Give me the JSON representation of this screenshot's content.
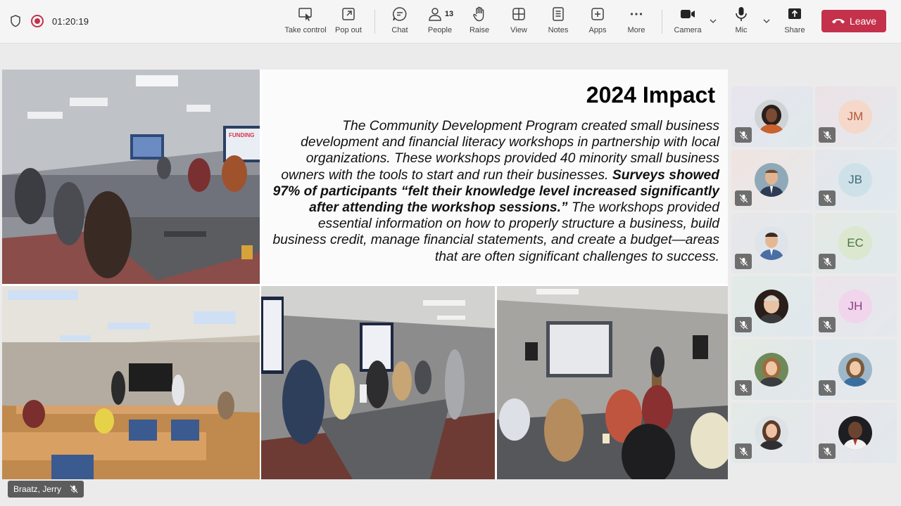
{
  "meeting": {
    "timer": "01:20:19"
  },
  "toolbar": {
    "take_control": "Take control",
    "pop_out": "Pop out",
    "chat": "Chat",
    "people": "People",
    "people_count": "13",
    "raise": "Raise",
    "view": "View",
    "notes": "Notes",
    "apps": "Apps",
    "more": "More",
    "camera": "Camera",
    "mic": "Mic",
    "share": "Share",
    "leave": "Leave"
  },
  "slide": {
    "title": "2024 Impact",
    "body_part1": "The Community Development Program created small business development and financial literacy workshops in partnership with local organizations. These workshops provided 40 minority small business owners with the tools to start and run their businesses.",
    "body_bold": "Surveys showed 97% of participants “felt their knowledge level increased significantly after attending the workshop sessions.”",
    "body_part2": "The workshops provided essential information on how to properly structure a business, build business credit, manage financial statements, and create a budget—areas that are often significant challenges to success.",
    "photo_screen_text": "FUNDING"
  },
  "participants": {
    "p2": "JM",
    "p4": "JB",
    "p6": "EC",
    "p8": "JH"
  },
  "colors": {
    "leave_button": "#c4314b",
    "recording": "#c4314b",
    "mute_badge": "#6e6e6e"
  },
  "presenter": {
    "name": "Braatz, Jerry"
  }
}
